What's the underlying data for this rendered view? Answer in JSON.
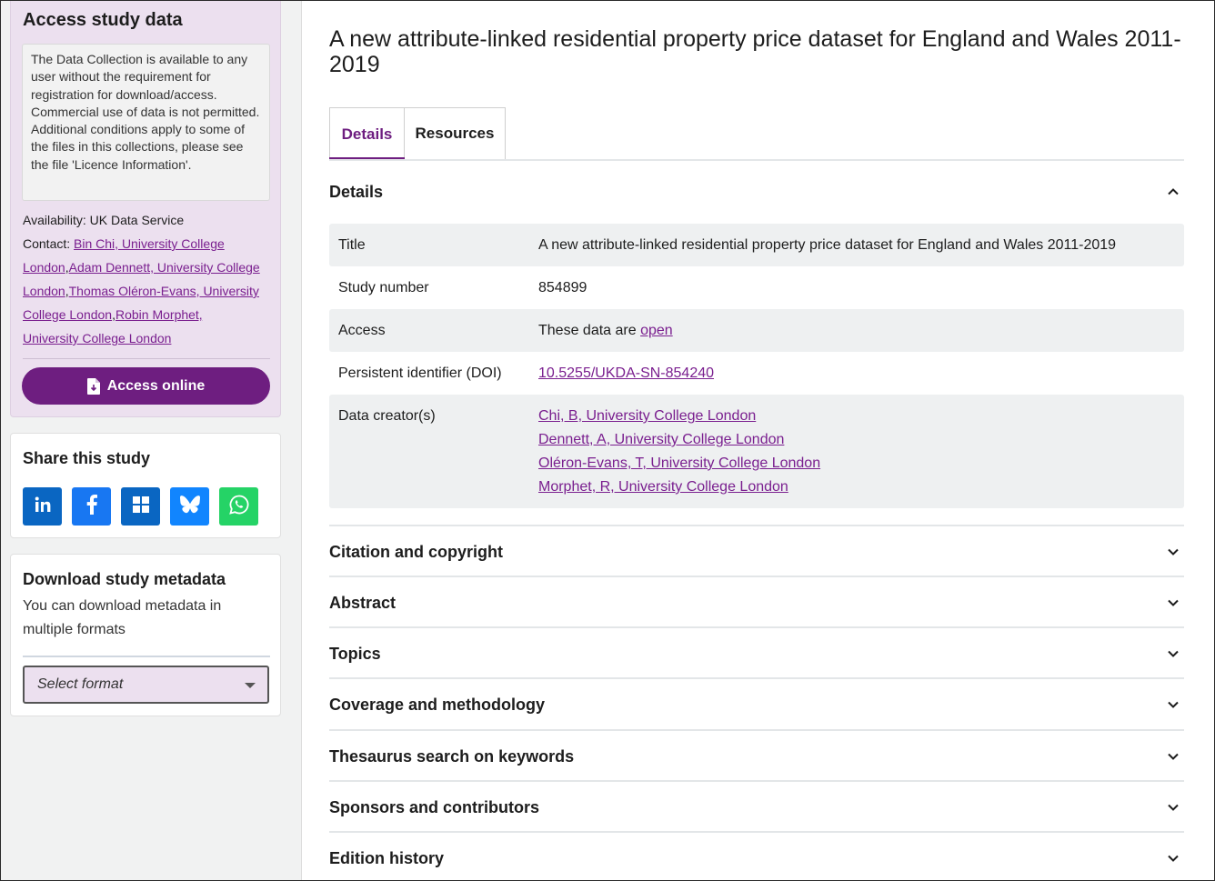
{
  "sidebar": {
    "access": {
      "title": "Access study data",
      "note": "The Data Collection is available to any user without the requirement for registration for download/access. Commercial use of data is not permitted. Additional conditions apply to some of the files in this collections, please see the file 'Licence Information'.",
      "availability_label": "Availability:",
      "availability_value": "UK Data Service",
      "contact_label": "Contact:",
      "contacts": [
        "Bin Chi, University College London",
        "Adam Dennett, University College London",
        "Thomas Oléron-Evans, University College London",
        "Robin Morphet, University College London"
      ],
      "button_label": "Access online"
    },
    "share": {
      "title": "Share this study",
      "buttons": [
        {
          "name": "linkedin-icon",
          "color": "#0a66c2"
        },
        {
          "name": "facebook-icon",
          "color": "#1877f2"
        },
        {
          "name": "microsoft-icon",
          "color": "#0a66c2"
        },
        {
          "name": "bluesky-icon",
          "color": "#1185fe"
        },
        {
          "name": "whatsapp-icon",
          "color": "#25d366"
        }
      ]
    },
    "download": {
      "title": "Download study metadata",
      "text": "You can download metadata in multiple formats",
      "select_placeholder": "Select format"
    }
  },
  "main": {
    "title": "A new attribute-linked residential property price dataset for England and Wales 2011-2019",
    "tabs": [
      {
        "label": "Details",
        "active": true
      },
      {
        "label": "Resources",
        "active": false
      }
    ],
    "details_section": {
      "label": "Details",
      "rows": {
        "title_key": "Title",
        "title_value": "A new attribute-linked residential property price dataset for England and Wales 2011-2019",
        "study_key": "Study number",
        "study_value": "854899",
        "access_key": "Access",
        "access_prefix": "These data are",
        "access_link": "open",
        "doi_key": "Persistent identifier (DOI)",
        "doi_value": "10.5255/UKDA-SN-854240",
        "creators_key": "Data creator(s)",
        "creators": [
          "Chi, B, University College London",
          "Dennett, A, University College London",
          "Oléron-Evans, T, University College London",
          "Morphet, R, University College London"
        ]
      }
    },
    "sections": [
      "Citation and copyright",
      "Abstract",
      "Topics",
      "Coverage and methodology",
      "Thesaurus search on keywords",
      "Sponsors and contributors",
      "Edition history"
    ]
  },
  "colors": {
    "brand_purple": "#6e1e80",
    "link_purple": "#7a1f8f",
    "access_panel": "#ece0ef"
  }
}
